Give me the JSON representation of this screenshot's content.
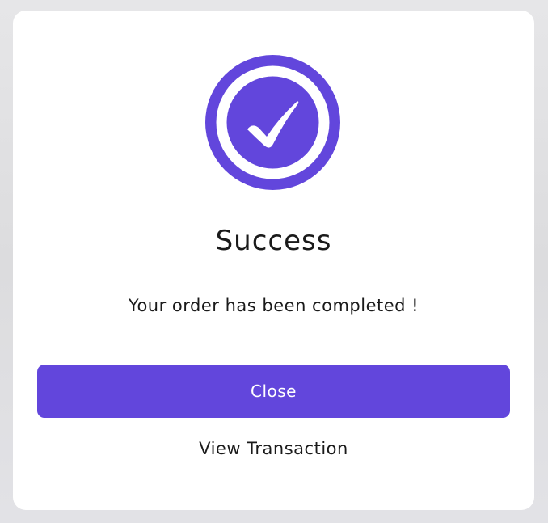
{
  "dialog": {
    "icon": "success-check-icon",
    "title": "Success",
    "message": "Your order has been completed !",
    "close_label": "Close",
    "view_transaction_label": "View Transaction"
  },
  "colors": {
    "accent": "#6246dc",
    "text": "#1a1a1a",
    "card": "#ffffff",
    "backdrop": "#e0e0e2"
  }
}
